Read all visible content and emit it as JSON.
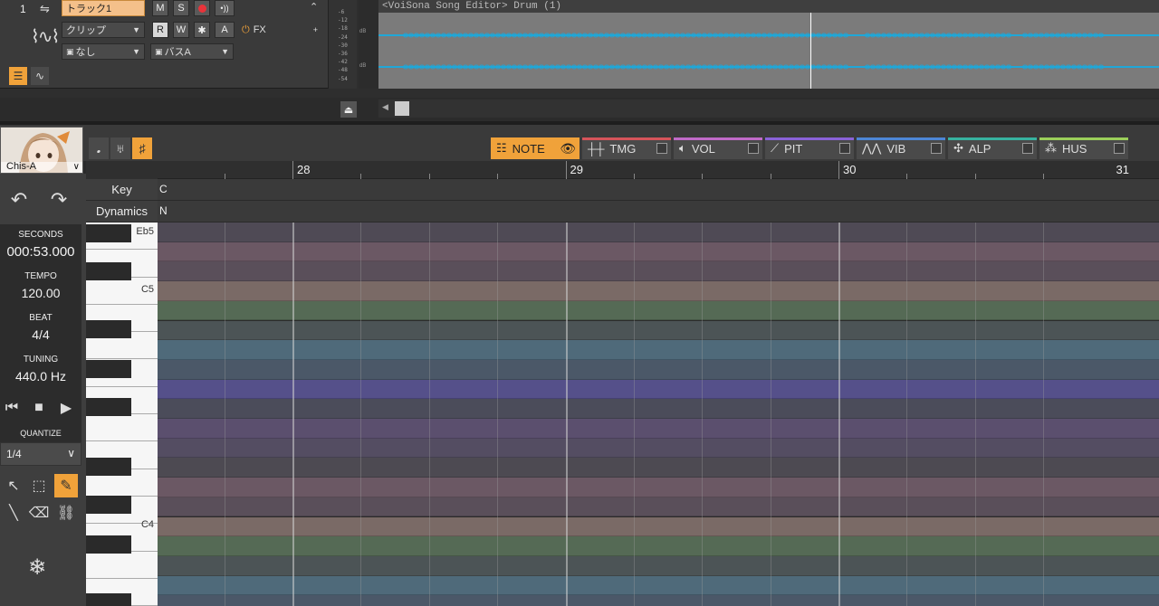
{
  "track": {
    "number": "1",
    "name": "トラック1",
    "clip_label": "クリップ",
    "none_label": "なし",
    "bus_label": "バスA",
    "fx_label": "FX",
    "buttons": {
      "mute": "M",
      "solo": "S",
      "read": "R",
      "write": "W",
      "asterisk": "✱",
      "auto": "A"
    }
  },
  "meter": {
    "db_ticks": [
      "-6",
      "-12",
      "-18",
      "-24",
      "-30",
      "-36",
      "-42",
      "-48",
      "-54"
    ],
    "db_label": "dB"
  },
  "lane": {
    "title": "<VoiSona Song Editor> Drum (1)"
  },
  "avatar": {
    "name": "Chis-A"
  },
  "tabs": [
    {
      "id": "note",
      "label": "NOTE",
      "color": "#f0a23a"
    },
    {
      "id": "tmg",
      "label": "TMG",
      "color": "#d6545a"
    },
    {
      "id": "vol",
      "label": "VOL",
      "color": "#c06ac8"
    },
    {
      "id": "pit",
      "label": "PIT",
      "color": "#8a62d8"
    },
    {
      "id": "vib",
      "label": "VIB",
      "color": "#4d86d6"
    },
    {
      "id": "alp",
      "label": "ALP",
      "color": "#37b3a0"
    },
    {
      "id": "hus",
      "label": "HUS",
      "color": "#9bcf5a"
    }
  ],
  "ruler": {
    "bars": [
      "28",
      "29",
      "30",
      "31"
    ]
  },
  "rows": {
    "key_label": "Key",
    "key_value": "C",
    "dynamics_label": "Dynamics",
    "dynamics_value": "N"
  },
  "left_panel": {
    "seconds_label": "SECONDS",
    "seconds_value": "000:53.000",
    "tempo_label": "TEMPO",
    "tempo_value": "120.00",
    "beat_label": "BEAT",
    "beat_value": "4/4",
    "tuning_label": "TUNING",
    "tuning_value": "440.0 Hz",
    "quantize_label": "QUANTIZE",
    "quantize_value": "1/4"
  },
  "piano": {
    "labels": [
      "Eb5",
      "C5",
      "C4"
    ]
  },
  "colors": {
    "accent": "#f0a23a",
    "lane_line": "#1fa7d8"
  }
}
